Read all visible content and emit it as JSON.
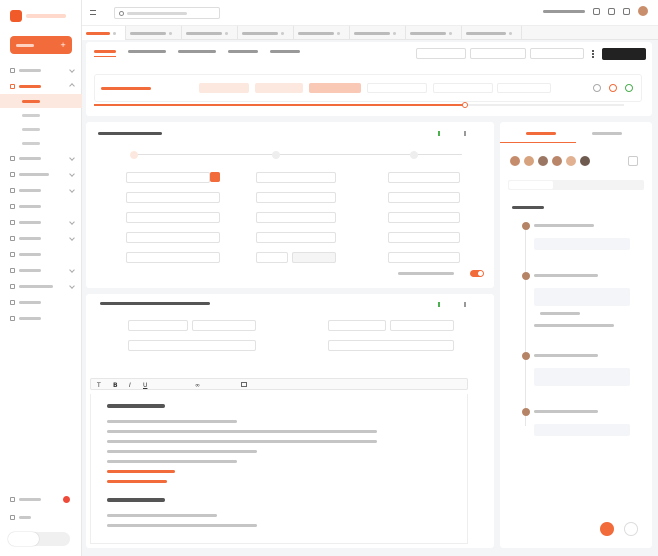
{
  "colors": {
    "accent": "#f26b3a",
    "accent_light": "#fde8df",
    "dark_button": "#222222",
    "status_red": "#f04a3a"
  },
  "icons": [
    "menu-icon",
    "search-icon",
    "bell-icon",
    "settings-icon",
    "avatar",
    "plus-icon",
    "close-icon",
    "chevron-down-icon",
    "send-icon",
    "check-icon",
    "bold-icon",
    "italic-icon",
    "underline-icon",
    "link-icon",
    "image-icon",
    "ai-assistant-icon",
    "robot-icon"
  ],
  "progress": {
    "value": 0.7
  },
  "toggle": {
    "on": true
  }
}
